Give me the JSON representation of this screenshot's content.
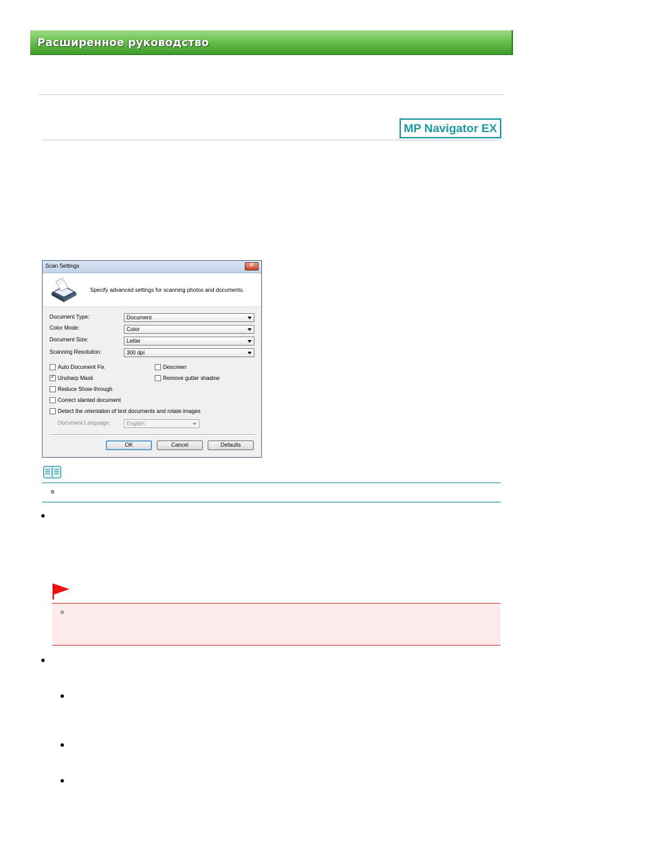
{
  "header": {
    "title": "Расширенное руководство"
  },
  "product_logo": {
    "text": "MP Navigator EX"
  },
  "dialog": {
    "title": "Scan Settings",
    "close_symbol": "✕",
    "description": "Specify advanced settings for scanning photos and documents.",
    "fields": [
      {
        "label": "Document Type:",
        "value": "Document"
      },
      {
        "label": "Color Mode:",
        "value": "Color"
      },
      {
        "label": "Document Size:",
        "value": "Letter"
      },
      {
        "label": "Scanning Resolution:",
        "value": "300 dpi"
      }
    ],
    "checkboxes": {
      "auto_document_fix": {
        "label": "Auto Document Fix",
        "checked": false
      },
      "descreen": {
        "label": "Descreen",
        "checked": false
      },
      "unsharp_mask": {
        "label": "Unsharp Mask",
        "checked": true
      },
      "remove_gutter_shadow": {
        "label": "Remove gutter shadow",
        "checked": false
      },
      "reduce_show_through": {
        "label": "Reduce Show-through",
        "checked": false
      },
      "correct_slanted": {
        "label": "Correct slanted document",
        "checked": false
      },
      "detect_orientation": {
        "label": "Detect the orientation of text documents and rotate images",
        "checked": false
      }
    },
    "document_language": {
      "label": "Document Language:",
      "value": "English"
    },
    "buttons": {
      "ok": "OK",
      "cancel": "Cancel",
      "defaults": "Defaults"
    },
    "tick_symbol": "✓"
  },
  "icons": {
    "note": "note-book-icon",
    "important": "red-flag-icon",
    "scanner": "scanner-icon"
  },
  "colors": {
    "header_green": "#6cc24f",
    "logo_teal": "#1a9aa0",
    "note_rule": "#2c8fa0",
    "important_red": "#d04040",
    "important_bg": "#fcebea"
  }
}
